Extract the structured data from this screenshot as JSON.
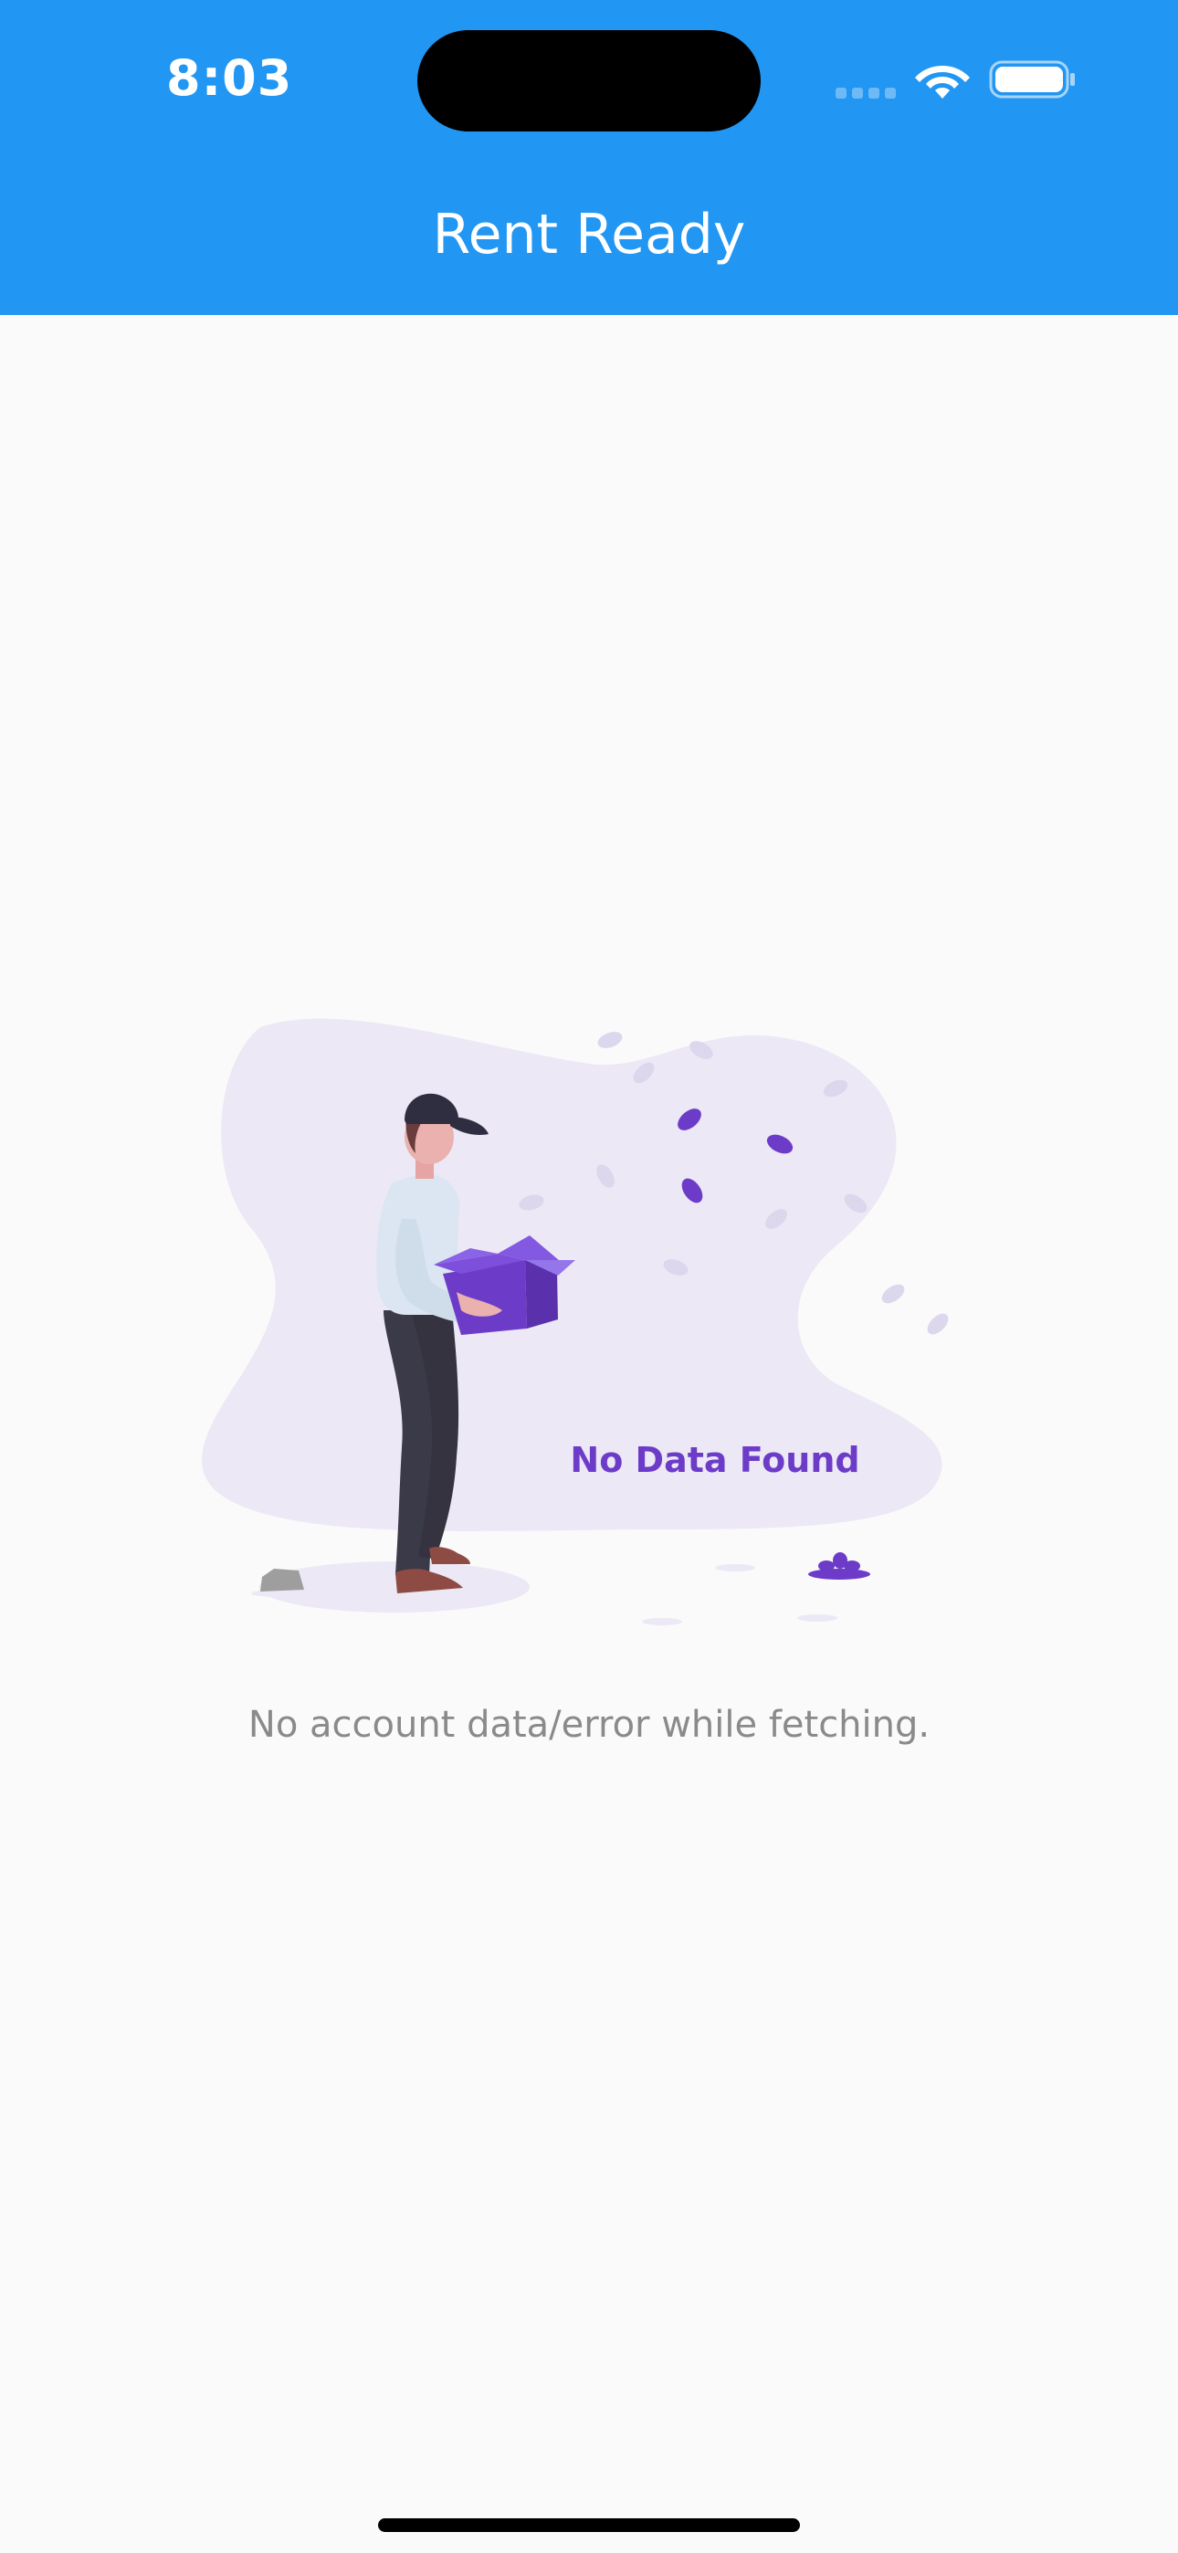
{
  "status_bar": {
    "time": "8:03",
    "icons": [
      "signal-icon",
      "wifi-icon",
      "battery-icon"
    ]
  },
  "app_bar": {
    "title": "Rent Ready",
    "color": "#2196f3"
  },
  "empty_state": {
    "illustration_text": "No Data Found",
    "message": "No account data/error while fetching.",
    "accent_color": "#6c3cc9"
  }
}
